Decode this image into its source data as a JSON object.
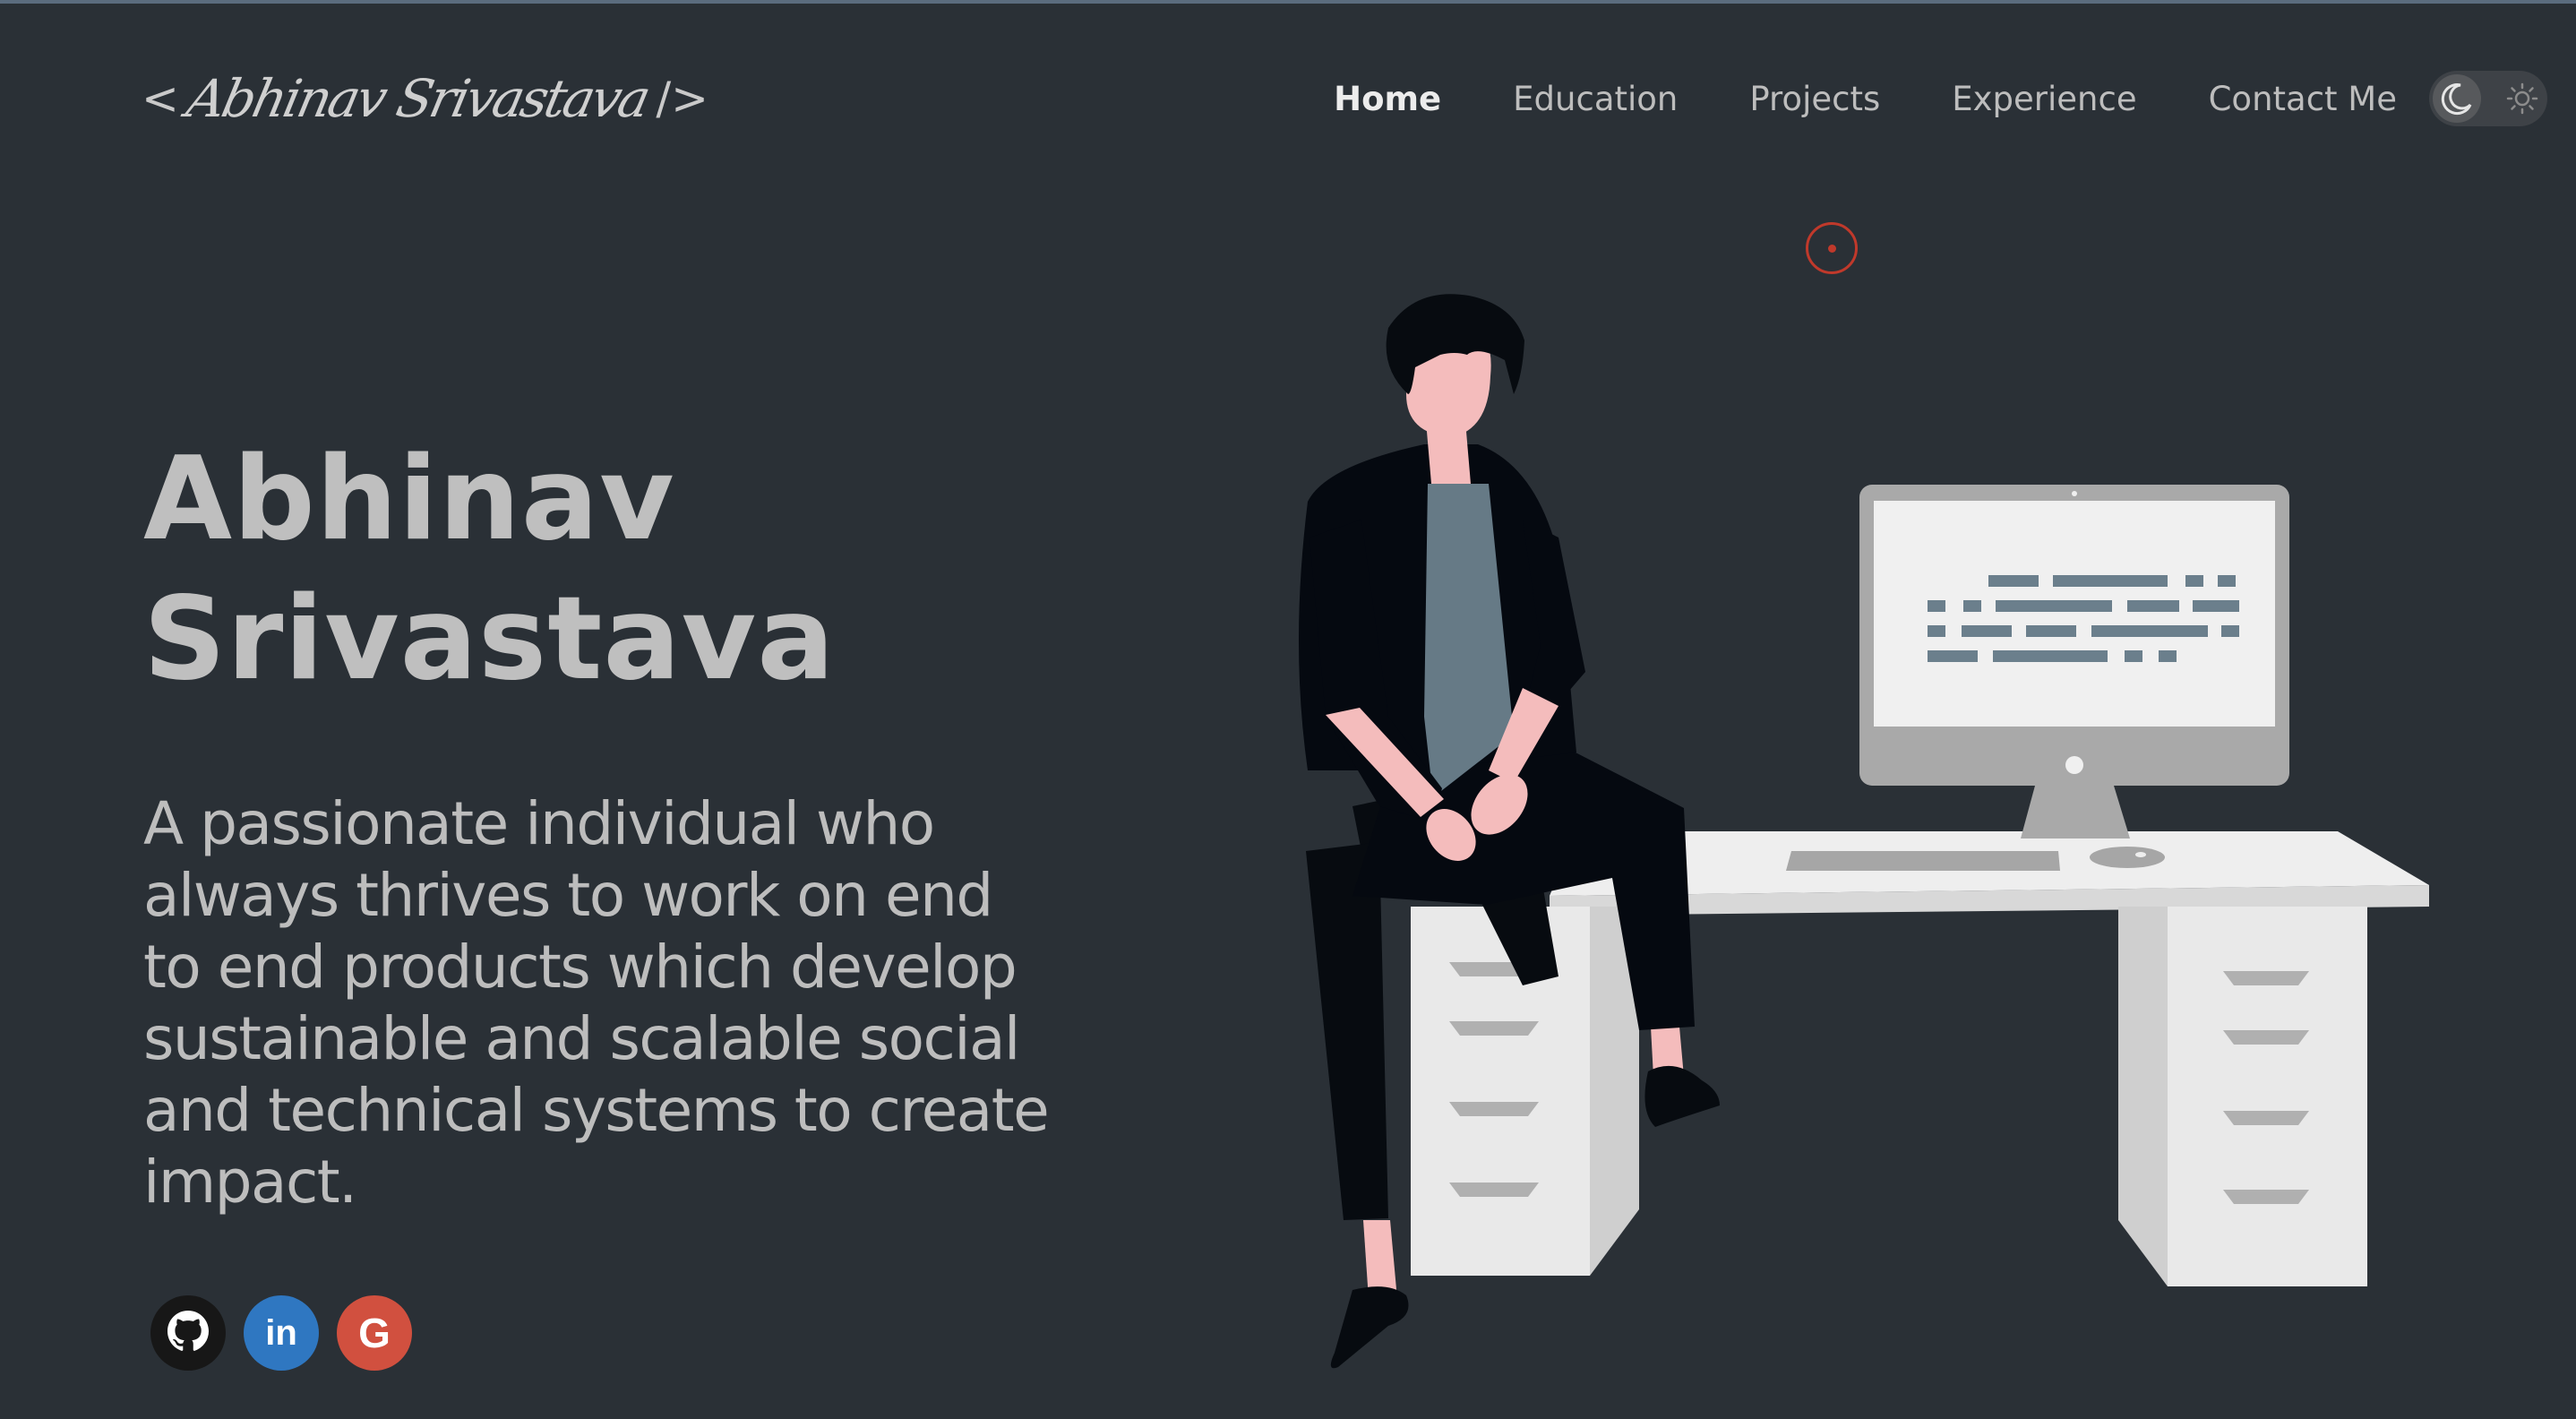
{
  "header": {
    "logo": {
      "open_bracket": "<",
      "name": "Abhinav Srivastava",
      "close_bracket": "/>"
    },
    "nav": [
      {
        "label": "Home",
        "active": true
      },
      {
        "label": "Education"
      },
      {
        "label": "Projects"
      },
      {
        "label": "Experience"
      },
      {
        "label": "Contact Me"
      }
    ],
    "theme_toggle": {
      "state": "dark",
      "icons": [
        "moon-icon",
        "sun-icon"
      ]
    }
  },
  "hero": {
    "name_lines": [
      "Abhinav",
      "Srivastava"
    ],
    "description_lines": [
      "A passionate individual who",
      "always thrives to work on end",
      "to end products which develop",
      "sustainable and scalable social",
      "and technical systems to create",
      "impact."
    ]
  },
  "social": [
    {
      "name": "github",
      "icon": "github-icon",
      "color": "#171717"
    },
    {
      "name": "linkedin",
      "icon": "linkedin-icon",
      "glyph": "in",
      "color": "#2f77c1"
    },
    {
      "name": "google",
      "icon": "google-icon",
      "glyph": "G",
      "color": "#d1503f"
    }
  ],
  "colors": {
    "background": "#2a3036",
    "text": "#bdbdbd",
    "accent_cursor": "#c0392b"
  }
}
